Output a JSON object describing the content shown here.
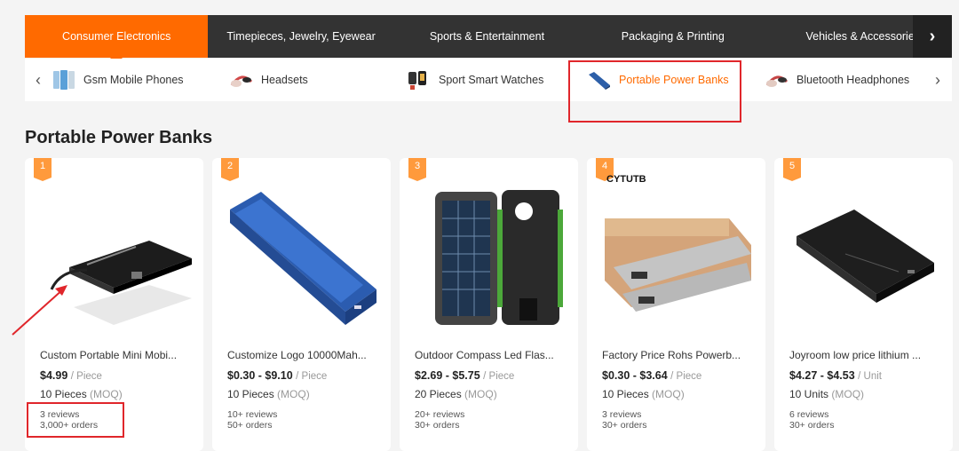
{
  "categories": {
    "items": [
      {
        "label": "Consumer Electronics",
        "active": true
      },
      {
        "label": "Timepieces, Jewelry, Eyewear",
        "active": false
      },
      {
        "label": "Sports & Entertainment",
        "active": false
      },
      {
        "label": "Packaging & Printing",
        "active": false
      },
      {
        "label": "Vehicles & Accessories",
        "active": false
      }
    ],
    "next_label": "›",
    "accent": "#ff6a00"
  },
  "subcategories": {
    "prev_label": "‹",
    "next_label": "›",
    "items": [
      {
        "label": "Gsm Mobile Phones",
        "icon": "phone-icon"
      },
      {
        "label": "Headsets",
        "icon": "headset-icon"
      },
      {
        "label": "Sport Smart Watches",
        "icon": "watch-icon"
      },
      {
        "label": "Portable Power Banks",
        "icon": "powerbank-icon",
        "active": true
      },
      {
        "label": "Bluetooth Headphones",
        "icon": "headphones-icon"
      }
    ]
  },
  "section": {
    "title": "Portable Power Banks"
  },
  "products": [
    {
      "rank": "1",
      "brand": "",
      "title": "Custom Portable Mini Mobi...",
      "price": "$4.99",
      "unit": "/ Piece",
      "moq_qty": "10 Pieces",
      "moq_label": "(MOQ)",
      "reviews": "3 reviews",
      "orders": "3,000+ orders"
    },
    {
      "rank": "2",
      "brand": "",
      "title": "Customize Logo 10000Mah...",
      "price": "$0.30 - $9.10",
      "unit": "/ Piece",
      "moq_qty": "10 Pieces",
      "moq_label": "(MOQ)",
      "reviews": "10+ reviews",
      "orders": "50+ orders"
    },
    {
      "rank": "3",
      "brand": "",
      "title": "Outdoor Compass Led Flas...",
      "price": "$2.69 - $5.75",
      "unit": "/ Piece",
      "moq_qty": "20 Pieces",
      "moq_label": "(MOQ)",
      "reviews": "20+ reviews",
      "orders": "30+ orders"
    },
    {
      "rank": "4",
      "brand": "CYTUTB",
      "title": "Factory Price Rohs Powerb...",
      "price": "$0.30 - $3.64",
      "unit": "/ Piece",
      "moq_qty": "10 Pieces",
      "moq_label": "(MOQ)",
      "reviews": "3 reviews",
      "orders": "30+ orders"
    },
    {
      "rank": "5",
      "brand": "",
      "title": "Joyroom low price lithium ...",
      "price": "$4.27 - $4.53",
      "unit": "/ Unit",
      "moq_qty": "10 Units",
      "moq_label": "(MOQ)",
      "reviews": "6 reviews",
      "orders": "30+ orders"
    }
  ]
}
